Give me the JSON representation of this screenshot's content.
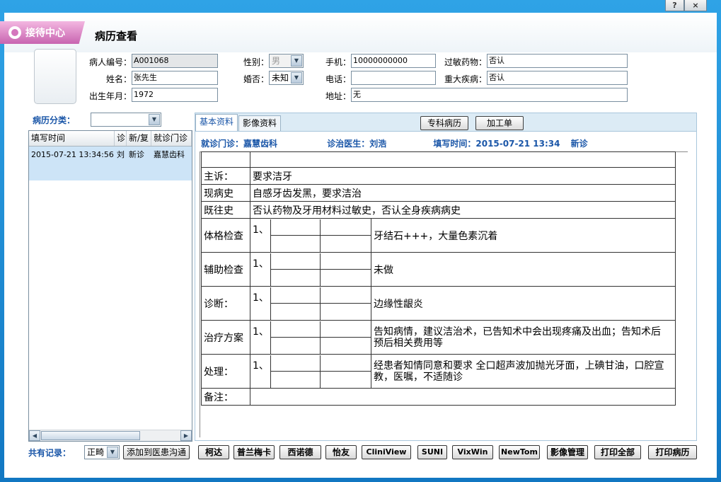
{
  "titlebar": {
    "help_label": "?",
    "close_label": "×"
  },
  "header": {
    "logo_text": "接待中心",
    "page_title": "病历查看"
  },
  "patient": {
    "id_label": "病人编号：",
    "id_value": "A001068",
    "gender_label": "性别：",
    "gender_value": "男",
    "mobile_label": "手机：",
    "mobile_value": "10000000000",
    "allergy_label": "过敏药物：",
    "allergy_value": "否认",
    "name_label": "姓名：",
    "name_value": "张先生",
    "married_label": "婚否：",
    "married_value": "未知",
    "phone_label": "电话：",
    "phone_value": "",
    "disease_label": "重大疾病：",
    "disease_value": "否认",
    "birth_label": "出生年月：",
    "birth_value": "1972",
    "address_label": "地址：",
    "address_value": "无"
  },
  "category": {
    "label": "病历分类：",
    "value": ""
  },
  "record_list": {
    "columns": [
      "填写时间",
      "诊",
      "新/复",
      "就诊门诊"
    ],
    "rows": [
      {
        "time": "2015-07-21 13:34:56",
        "doctor": "刘",
        "type": "新诊",
        "clinic": "嘉慧齿科"
      }
    ]
  },
  "tabs": {
    "basic": "基本资料",
    "image": "影像资料",
    "specialty_btn": "专科病历",
    "process_btn": "加工单"
  },
  "record_info": {
    "clinic": "就诊门诊：嘉慧齿科",
    "doctor": "诊治医生：刘浩",
    "time": "填写时间：2015-07-21 13:34",
    "type": "新诊"
  },
  "record": {
    "complaint_label": "主诉：",
    "complaint": "要求洁牙",
    "history_label": "现病史",
    "history": "自感牙齿发黑，要求洁治",
    "past_label": "既往史",
    "past": "否认药物及牙用材料过敏史，否认全身疾病病史",
    "exam_label": "体格检查",
    "exam_no": "1、",
    "exam": "牙结石+++，大量色素沉着",
    "aux_label": "辅助检查",
    "aux_no": "1、",
    "aux": "未做",
    "diag_label": "诊断：",
    "diag_no": "1、",
    "diag": "边缘性龈炎",
    "plan_label": "治疗方案",
    "plan_no": "1、",
    "plan": "告知病情，建议洁治术，已告知术中会出现疼痛及出血；告知术后  预后相关费用等",
    "treat_label": "处理：",
    "treat_no": "1、",
    "treat": "经患者知情同意和要求 全口超声波加抛光牙面，上碘甘油，口腔宣教，医嘱，不适随诊",
    "note_label": "备注：",
    "note": ""
  },
  "bottom": {
    "total_label": "共有记录：",
    "select_value": "正畸",
    "add_btn": "添加到医患沟通",
    "buttons": [
      "柯达",
      "普兰梅卡",
      "西诺德",
      "怡友",
      "CliniView",
      "SUNI",
      "VixWin",
      "NewTom",
      "影像管理",
      "打印全部",
      "打印病历"
    ]
  },
  "colors": {
    "accent_blue": "#1a56a8",
    "selected_row": "#cde4f7",
    "window_frame": "#1a8ad0",
    "logo_pink": "#c864b0"
  }
}
